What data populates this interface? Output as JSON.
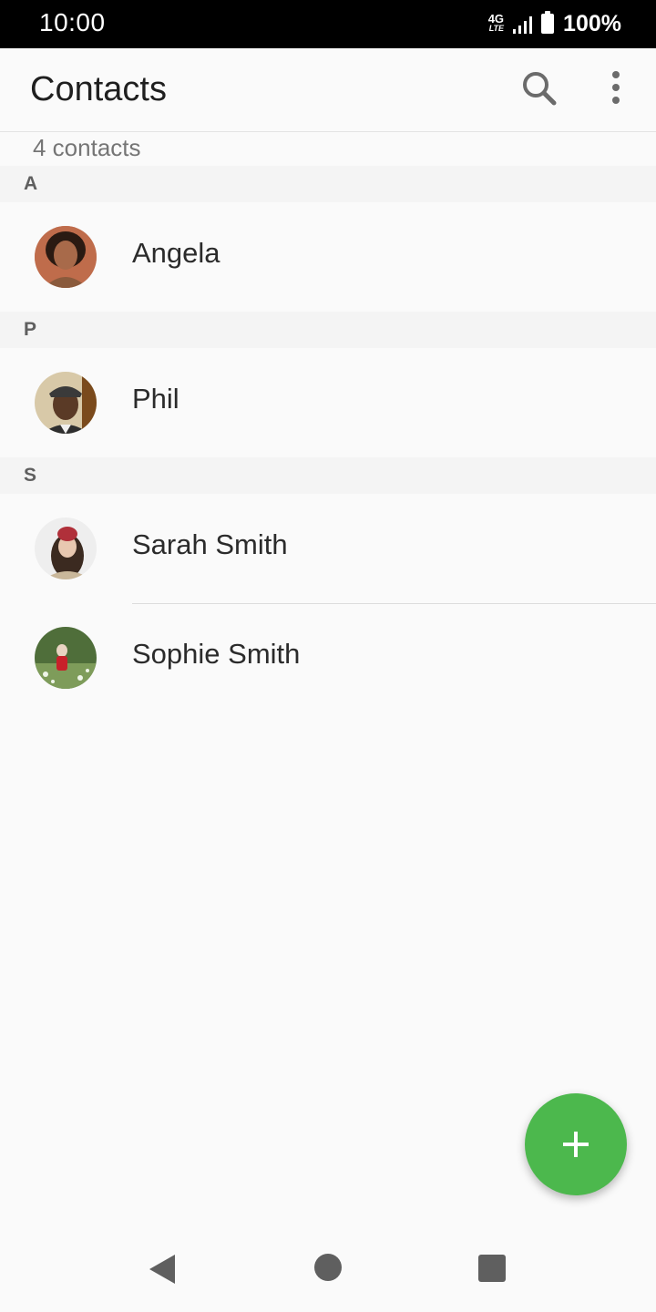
{
  "status_bar": {
    "time": "10:00",
    "network": "4G",
    "network_sub": "LTE",
    "battery": "100%"
  },
  "app_bar": {
    "title": "Contacts",
    "search_icon": "search-icon",
    "more_icon": "more-vert-icon"
  },
  "count_label": "4 contacts",
  "sections": [
    {
      "letter": "A",
      "contacts": [
        {
          "name": "Angela"
        }
      ]
    },
    {
      "letter": "P",
      "contacts": [
        {
          "name": "Phil"
        }
      ]
    },
    {
      "letter": "S",
      "contacts": [
        {
          "name": "Sarah Smith"
        },
        {
          "name": "Sophie Smith"
        }
      ]
    }
  ],
  "fab": {
    "icon": "plus-icon",
    "color": "#4cb84d"
  },
  "nav": {
    "back_icon": "back-icon",
    "home_icon": "home-icon",
    "recents_icon": "recents-icon"
  }
}
